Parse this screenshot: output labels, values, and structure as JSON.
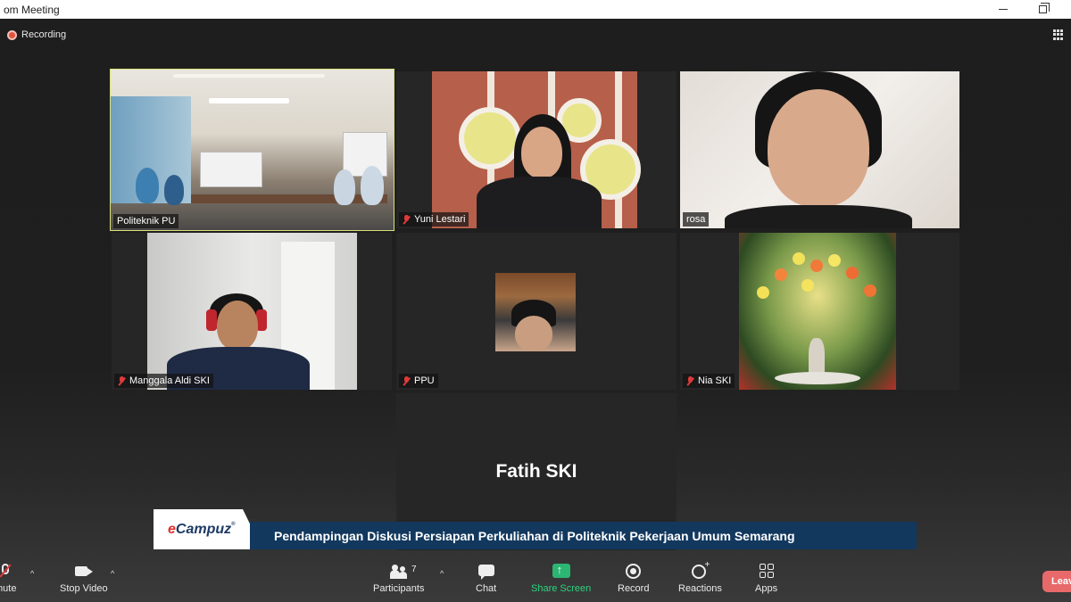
{
  "window": {
    "title": "om Meeting"
  },
  "meeting": {
    "recording_label": "Recording",
    "view_icon": "grid-view-icon"
  },
  "participants": [
    {
      "name": "Politeknik PU",
      "muted": false,
      "active": true
    },
    {
      "name": "Yuni Lestari",
      "muted": true,
      "active": false
    },
    {
      "name": "rosa",
      "muted": false,
      "active": false
    },
    {
      "name": "Manggala Aldi SKI",
      "muted": true,
      "active": false
    },
    {
      "name": "PPU",
      "muted": true,
      "active": false
    },
    {
      "name": "Nia SKI",
      "muted": true,
      "active": false
    },
    {
      "name": "Fatih SKI",
      "muted": false,
      "active": false
    }
  ],
  "banner": {
    "brand_prefix": "e",
    "brand_rest": "Campuz",
    "brand_mark": "®",
    "caption": "Pendampingan Diskusi Persiapan Perkuliahan di Politeknik Pekerjaan Umum Semarang"
  },
  "toolbar": {
    "unmute": "mute",
    "stop_video": "Stop Video",
    "participants": "Participants",
    "participants_count": "7",
    "chat": "Chat",
    "share_screen": "Share Screen",
    "record": "Record",
    "reactions": "Reactions",
    "apps": "Apps",
    "leave": "Leave"
  },
  "colors": {
    "active_speaker_outline": "#d8e07a",
    "share_green": "#2bb673",
    "caption_bg": "#12385e",
    "leave_red": "#e8696a",
    "muted_red": "#e03a3a"
  }
}
